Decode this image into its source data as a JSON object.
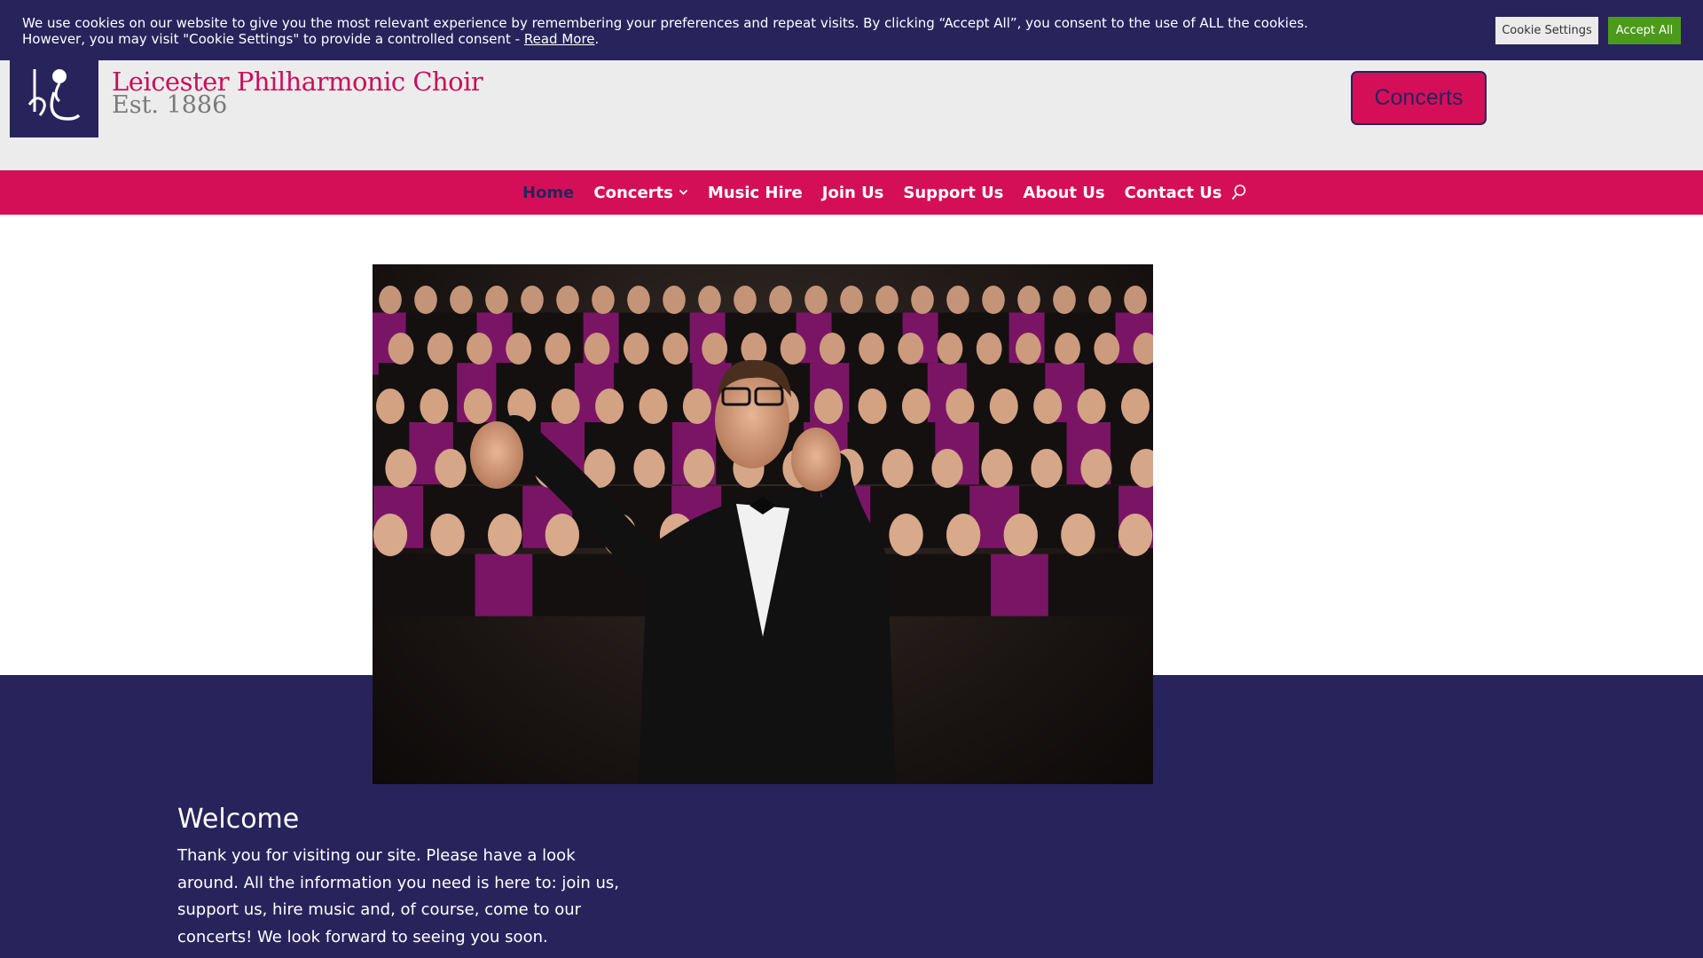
{
  "cookie_bar": {
    "message_line1": "We use cookies on our website to give you the most relevant experience by remembering your preferences and repeat visits. By clicking “Accept All”, you consent to the use of ALL the cookies.",
    "message_line2": "However, you may visit \"Cookie Settings\" to provide a controlled consent - ",
    "read_more": "Read More",
    "period": ".",
    "settings_label": "Cookie Settings",
    "accept_label": "Accept All"
  },
  "header": {
    "title": "Leicester Philharmonic Choir",
    "subtitle": "Est. 1886",
    "cta_label": "Concerts",
    "logo_icon": "lpc-monogram-logo"
  },
  "nav": {
    "items": [
      {
        "label": "Home",
        "active": true
      },
      {
        "label": "Concerts",
        "has_dropdown": true
      },
      {
        "label": "Music Hire"
      },
      {
        "label": "Join Us"
      },
      {
        "label": "Support Us"
      },
      {
        "label": "About Us"
      },
      {
        "label": "Contact Us"
      }
    ],
    "search_icon": "search-icon"
  },
  "main": {
    "hero_image": "choir-with-conductor-photo",
    "welcome_title": "Welcome",
    "welcome_text": "Thank you for visiting our site. Please have a look around. All the information you need is here to: join us, support us, hire music and, of course, come to our concerts! We look forward to seeing you soon."
  },
  "colors": {
    "brand_purple": "#29235c",
    "brand_pink": "#d40f58",
    "accept_green": "#4c9a1c",
    "header_grey": "#ececec"
  }
}
